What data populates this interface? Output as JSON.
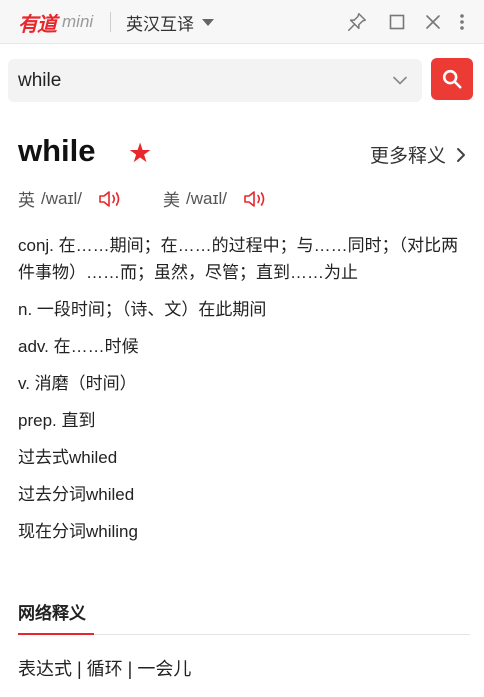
{
  "titlebar": {
    "logo": "有道",
    "logo_suffix": "mini",
    "mode_label": "英汉互译",
    "icons": [
      "pin-icon",
      "maximize-icon",
      "close-icon",
      "more-vertical-icon"
    ]
  },
  "search": {
    "value": "while",
    "placeholder": ""
  },
  "entry": {
    "word": "while",
    "star": "★",
    "more_label": "更多释义",
    "phonetics": [
      {
        "lang": "英",
        "ipa": "/waɪl/"
      },
      {
        "lang": "美",
        "ipa": "/waɪl/"
      }
    ],
    "definitions": [
      {
        "text": "conj. 在……期间；在……的过程中；与……同时；（对比两件事物）……而；虽然，尽管；直到……为止"
      },
      {
        "text": "n. 一段时间；（诗、文）在此期间"
      },
      {
        "text": "adv. 在……时候"
      },
      {
        "text": "v. 消磨（时间）"
      },
      {
        "text": "prep. 直到"
      },
      {
        "text": "过去式whiled"
      },
      {
        "text": "过去分词whiled"
      },
      {
        "text": "现在分词whiling"
      }
    ]
  },
  "network": {
    "title": "网络释义",
    "terms": "表达式 | 循环 | 一会儿"
  },
  "colors": {
    "brand_red": "#e8262b",
    "search_button": "#ec3b34"
  }
}
